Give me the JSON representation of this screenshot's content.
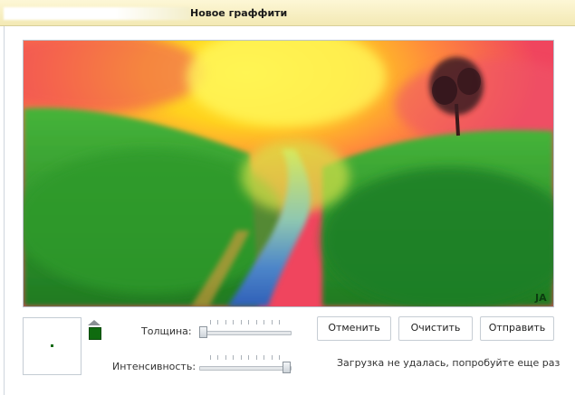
{
  "window": {
    "title": "Новое граффити"
  },
  "canvas": {
    "signature": "JA"
  },
  "controls": {
    "thickness_label": "Толщина:",
    "thickness_level": 0.0,
    "intensity_label": "Интенсивность:",
    "intensity_level": 1.0,
    "brush_color": "#0f6b0f"
  },
  "buttons": {
    "cancel": "Отменить",
    "clear": "Очистить",
    "send": "Отправить"
  },
  "status": {
    "message": "Загрузка не удалась, попробуйте еще раз"
  }
}
